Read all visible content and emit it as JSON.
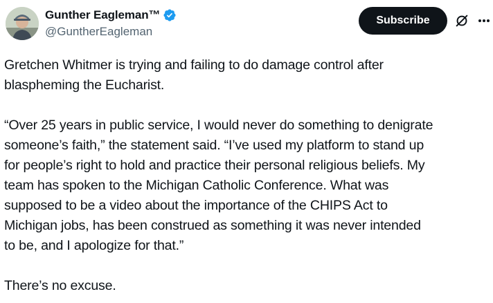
{
  "author": {
    "name": "Gunther Eagleman™",
    "handle": "@GuntherEagleman"
  },
  "subscribe_label": "Subscribe",
  "icons": {
    "avatar": "profile-photo",
    "verified": "verified-badge-icon",
    "grok": "grok-icon",
    "more": "more-options-icon"
  },
  "colors": {
    "verified": "#1d9bf0",
    "button_bg": "#0f1419",
    "handle": "#536471"
  },
  "tweet": {
    "p1": [
      "Gretchen Whitmer is trying and failing to do damage control after",
      "blaspheming the Eucharist."
    ],
    "p2": [
      "“Over 25 years in public service, I would never do something to denigrate",
      "someone’s faith,” the statement said. “I’ve used my platform to stand up",
      "for people’s right to hold and practice their personal religious beliefs. My",
      "team has spoken to the Michigan Catholic Conference. What was",
      "supposed to be a video about the importance of the CHIPS Act to",
      "Michigan jobs, has been construed as something it was never intended",
      "to be, and I apologize for that.”"
    ],
    "p3": [
      "There’s no excuse."
    ]
  }
}
